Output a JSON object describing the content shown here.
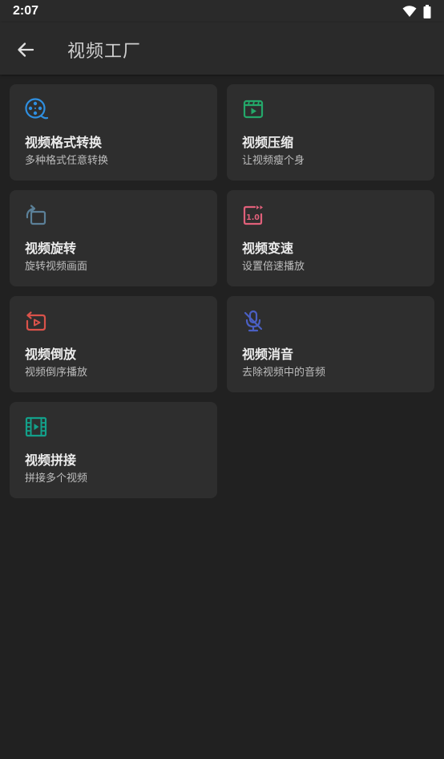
{
  "status_bar": {
    "time": "2:07",
    "icons": [
      "wifi-icon",
      "battery-icon"
    ]
  },
  "header": {
    "title": "视频工厂",
    "back_icon": "arrow-left-icon"
  },
  "colors": {
    "format": "#2f8fe0",
    "compress": "#24a86a",
    "rotate": "#5b8098",
    "speed": "#e0607a",
    "reverse": "#d9524a",
    "mute": "#4a5fc2",
    "join": "#13a08a"
  },
  "tools": [
    {
      "id": "format",
      "title": "视频格式转换",
      "subtitle": "多种格式任意转换",
      "icon": "film-reel-icon"
    },
    {
      "id": "compress",
      "title": "视频压缩",
      "subtitle": "让视频瘦个身",
      "icon": "video-file-icon"
    },
    {
      "id": "rotate",
      "title": "视频旋转",
      "subtitle": "旋转视频画面",
      "icon": "rotate-icon"
    },
    {
      "id": "speed",
      "title": "视频变速",
      "subtitle": "设置倍速播放",
      "icon": "playback-speed-icon"
    },
    {
      "id": "reverse",
      "title": "视频倒放",
      "subtitle": "视频倒序播放",
      "icon": "reverse-play-icon"
    },
    {
      "id": "mute",
      "title": "视频消音",
      "subtitle": "去除视频中的音频",
      "icon": "mic-off-icon"
    },
    {
      "id": "join",
      "title": "视频拼接",
      "subtitle": "拼接多个视频",
      "icon": "film-strip-icon"
    }
  ]
}
